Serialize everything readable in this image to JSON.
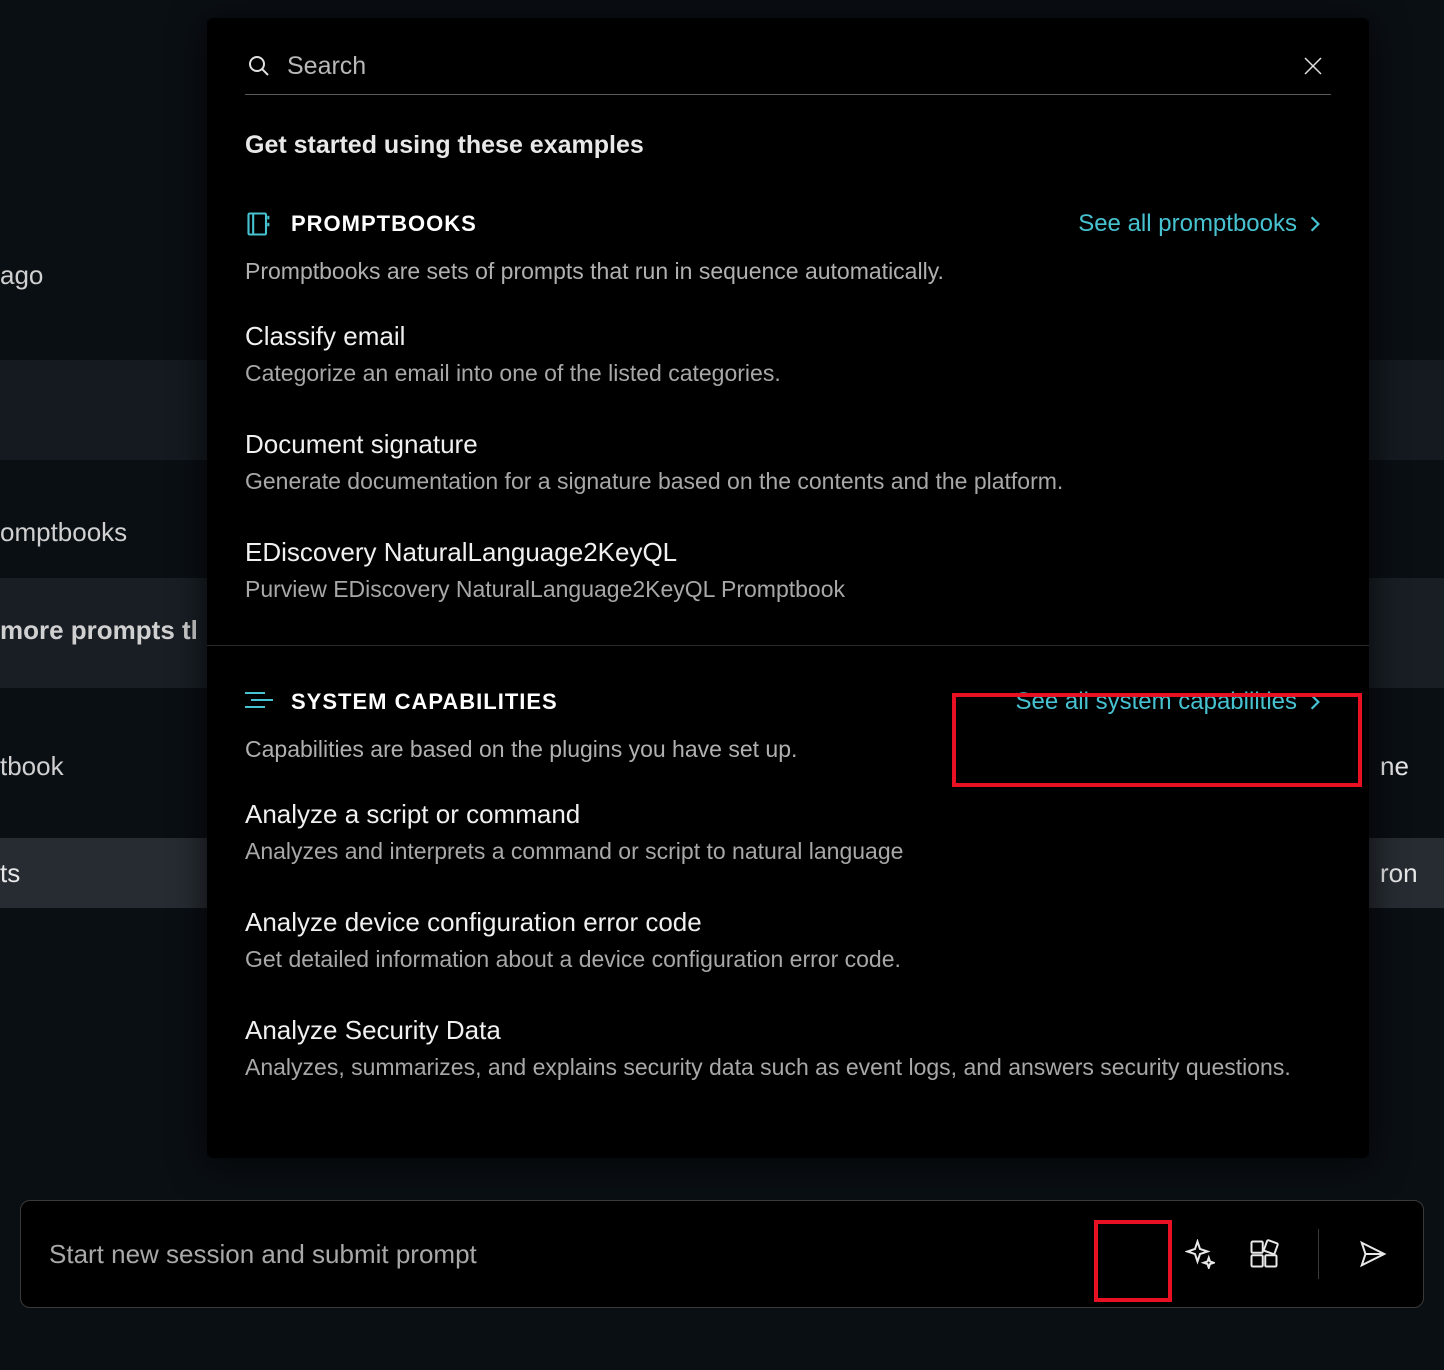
{
  "background": {
    "ago": "ago",
    "pbooks": "omptbooks",
    "more": "more prompts tl",
    "tbook": "tbook",
    "ts": "ts",
    "ron": "ron",
    "ne": "ne"
  },
  "search": {
    "placeholder": "Search"
  },
  "intro": "Get started using these examples",
  "promptbooks": {
    "title": "PROMPTBOOKS",
    "see_all": "See all promptbooks",
    "desc": "Promptbooks are sets of prompts that run in sequence automatically.",
    "items": [
      {
        "title": "Classify email",
        "desc": "Categorize an email into one of the listed categories."
      },
      {
        "title": "Document signature",
        "desc": "Generate documentation for a signature based on the contents and the platform."
      },
      {
        "title": "EDiscovery NaturalLanguage2KeyQL",
        "desc": "Purview EDiscovery NaturalLanguage2KeyQL Promptbook"
      }
    ]
  },
  "capabilities": {
    "title": "SYSTEM CAPABILITIES",
    "see_all": "See all system capabilities",
    "desc": "Capabilities are based on the plugins you have set up.",
    "items": [
      {
        "title": "Analyze a script or command",
        "desc": "Analyzes and interprets a command or script to natural language"
      },
      {
        "title": "Analyze device configuration error code",
        "desc": "Get detailed information about a device configuration error code."
      },
      {
        "title": "Analyze Security Data",
        "desc": "Analyzes, summarizes, and explains security data such as event logs, and answers security questions."
      }
    ]
  },
  "prompt_bar": {
    "placeholder": "Start new session and submit prompt"
  },
  "colors": {
    "accent": "#47c2d1",
    "highlight": "#e81123"
  }
}
